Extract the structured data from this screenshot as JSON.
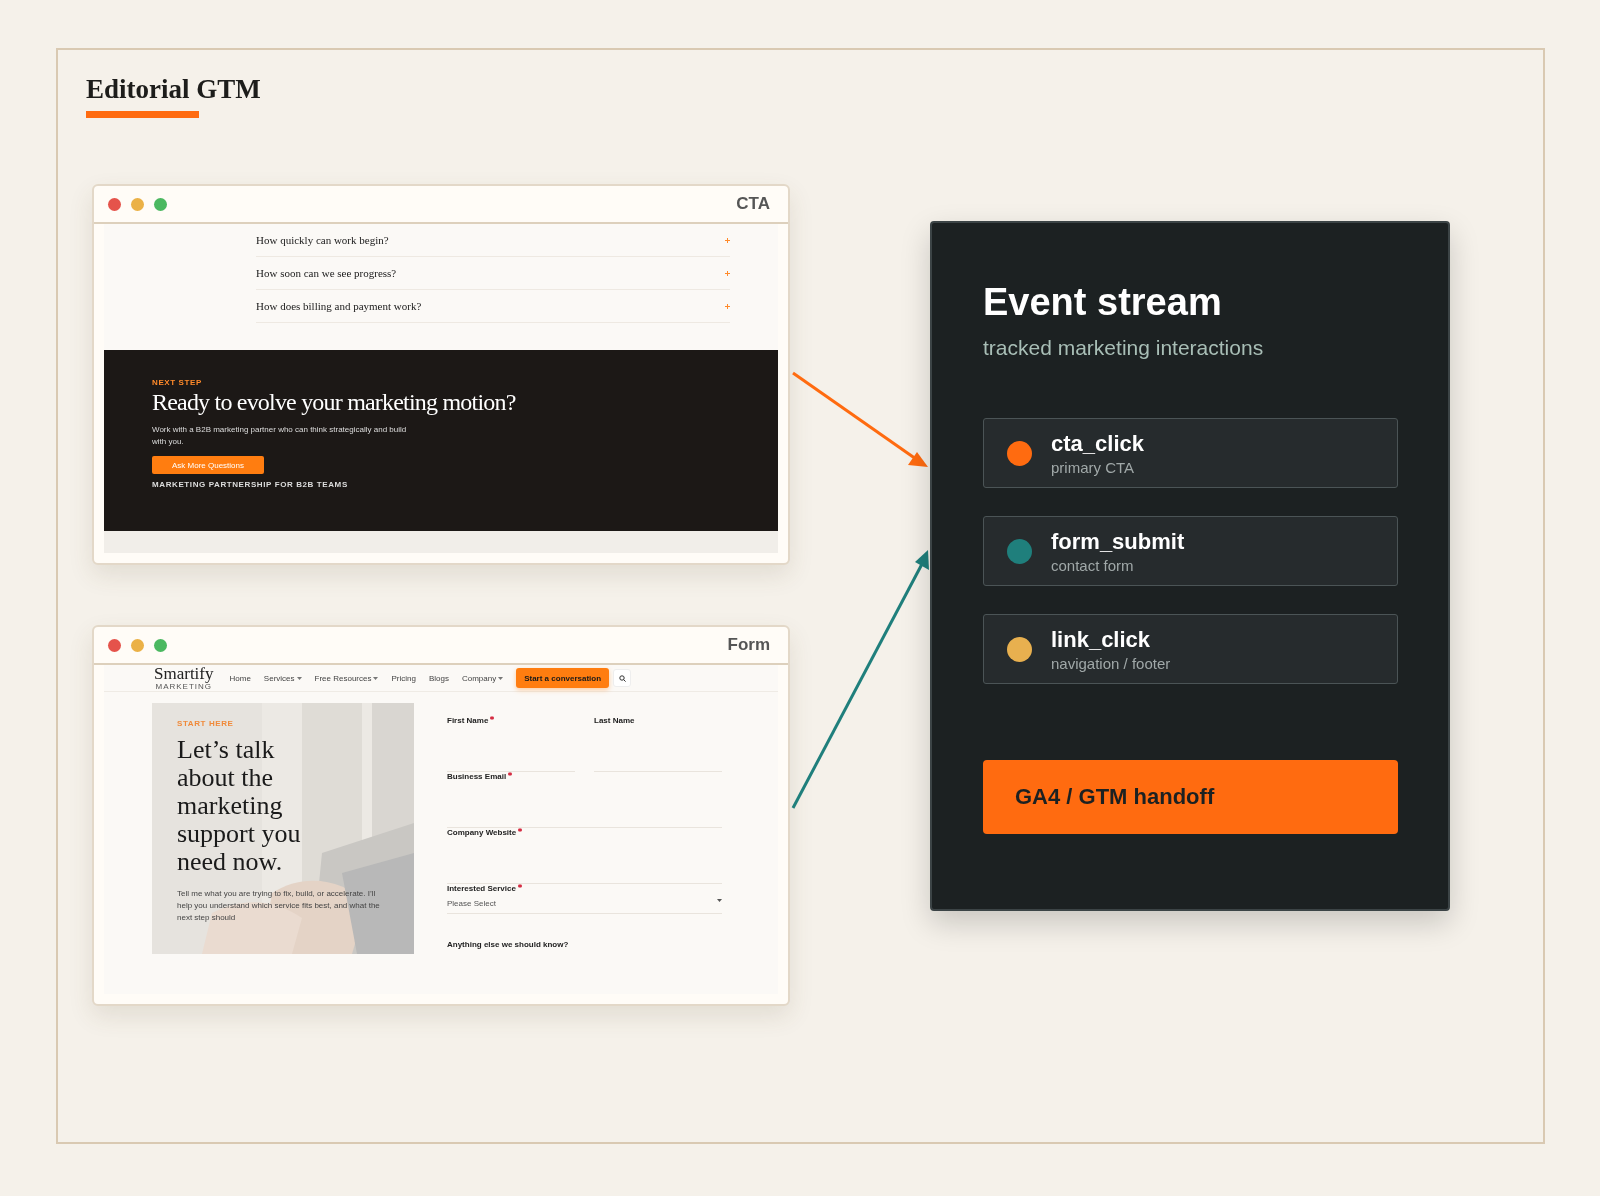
{
  "title": "Editorial GTM",
  "windows": [
    {
      "kind": "cta",
      "title": "CTA",
      "faq": [
        {
          "question": "How quickly can work begin?"
        },
        {
          "question": "How soon can we see progress?"
        },
        {
          "question": "How does billing and payment work?"
        }
      ],
      "cta": {
        "eyebrow": "NEXT STEP",
        "heading": "Ready to evolve your marketing motion?",
        "body": "Work with a B2B marketing partner who can think strategically and build with you.",
        "button": "Ask More Questions",
        "tagline": "MARKETING PARTNERSHIP FOR B2B TEAMS"
      }
    },
    {
      "kind": "form",
      "title": "Form",
      "nav": {
        "logo": "Smartify",
        "logo_sub": "MARKETING",
        "items": [
          {
            "label": "Home",
            "dropdown": false
          },
          {
            "label": "Services",
            "dropdown": true
          },
          {
            "label": "Free Resources",
            "dropdown": true
          },
          {
            "label": "Pricing",
            "dropdown": false
          },
          {
            "label": "Blogs",
            "dropdown": false
          },
          {
            "label": "Company",
            "dropdown": true
          }
        ],
        "button": "Start a conversation"
      },
      "hero": {
        "eyebrow": "START HERE",
        "heading": "Let’s talk about the marketing support you need now.",
        "body": "Tell me what you are trying to fix, build, or accelerate. I’ll help you understand which service fits best, and what the next step should"
      },
      "fields": [
        {
          "label": "First Name",
          "required": true,
          "kind": "half"
        },
        {
          "label": "Last Name",
          "required": false,
          "kind": "half"
        },
        {
          "label": "Business Email",
          "required": true,
          "kind": "text"
        },
        {
          "label": "Company Website",
          "required": true,
          "kind": "text"
        },
        {
          "label": "Interested Service",
          "required": true,
          "kind": "select",
          "placeholder": "Please Select"
        },
        {
          "label": "Anything else we should know?",
          "required": false,
          "kind": "label"
        }
      ]
    }
  ],
  "event_stream": {
    "title": "Event stream",
    "subtitle": "tracked marketing interactions",
    "events": [
      {
        "name": "cta_click",
        "detail": "primary CTA",
        "color": "#ff6b10"
      },
      {
        "name": "form_submit",
        "detail": "contact form",
        "color": "#1f7f7c"
      },
      {
        "name": "link_click",
        "detail": "navigation / footer",
        "color": "#e8b04f"
      }
    ],
    "handoff": "GA4 / GTM handoff"
  }
}
